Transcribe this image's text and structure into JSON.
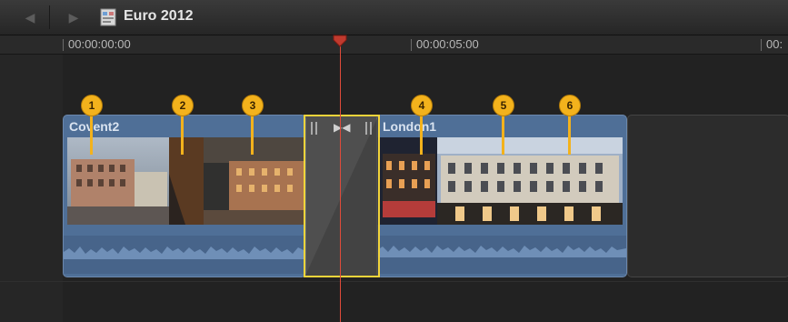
{
  "window": {
    "project_title": "Euro 2012",
    "nav": {
      "back_icon": "back-arrow-icon",
      "forward_icon": "forward-arrow-icon"
    }
  },
  "ruler": {
    "timecodes": [
      "00:00:00:00",
      "00:00:05:00",
      "00:"
    ]
  },
  "clips": [
    {
      "name": "Covent2"
    },
    {
      "name": "London1"
    }
  ],
  "markers": [
    "1",
    "2",
    "3",
    "4",
    "5",
    "6"
  ],
  "colors": {
    "clip_blue": "#4f6f97",
    "marker_yellow": "#f3b21c",
    "transition_border": "#f2d43a",
    "playhead_red": "#e04b3a"
  }
}
